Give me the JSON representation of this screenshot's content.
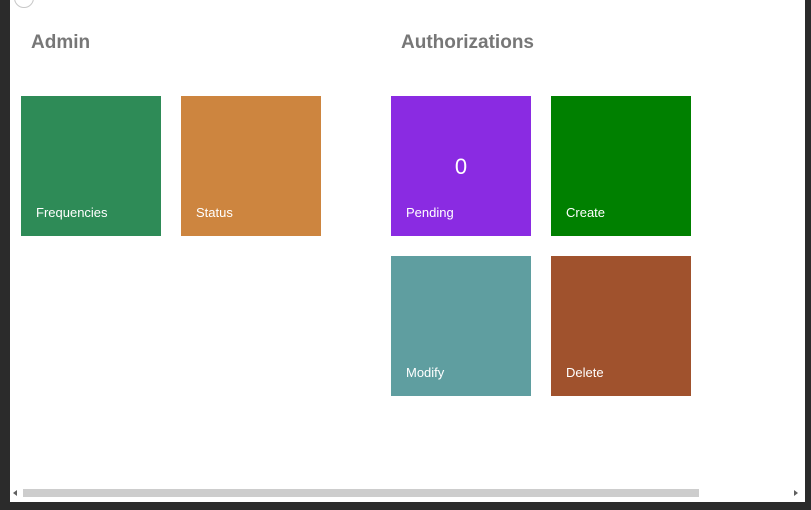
{
  "sections": {
    "admin": {
      "title": "Admin",
      "tiles": [
        {
          "label": "Frequencies",
          "color": "#2e8b57"
        },
        {
          "label": "Status",
          "color": "#cd853f"
        }
      ]
    },
    "authorizations": {
      "title": "Authorizations",
      "tiles": [
        {
          "label": "Pending",
          "count": "0",
          "color": "#8a2be2"
        },
        {
          "label": "Create",
          "color": "#008000"
        },
        {
          "label": "Modify",
          "color": "#5f9ea0"
        },
        {
          "label": "Delete",
          "color": "#a0522d"
        }
      ]
    }
  },
  "scrollbar": {
    "left_icon": "scroll-left-arrow-icon",
    "right_icon": "scroll-right-arrow-icon"
  }
}
